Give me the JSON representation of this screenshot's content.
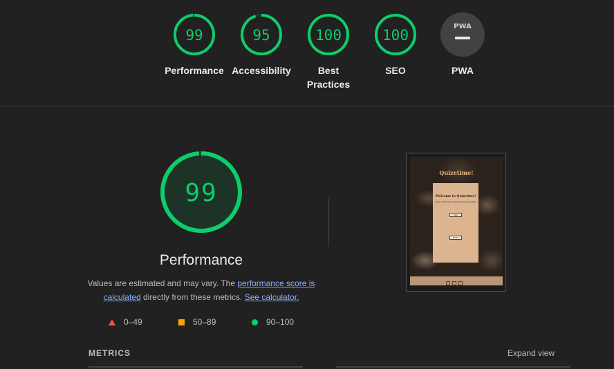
{
  "scores": [
    {
      "label": "Performance",
      "value": "99",
      "fraction": 0.99
    },
    {
      "label": "Accessibility",
      "value": "95",
      "fraction": 0.95
    },
    {
      "label": "Best Practices",
      "value": "100",
      "fraction": 1.0
    },
    {
      "label": "SEO",
      "value": "100",
      "fraction": 1.0
    },
    {
      "label": "PWA",
      "value": "",
      "badge_text": "PWA"
    }
  ],
  "main": {
    "score": "99",
    "score_fraction": 0.99,
    "title": "Performance",
    "desc_prefix": "Values are estimated and may vary. The ",
    "desc_link1": "performance score is calculated",
    "desc_middle": " directly from these metrics. ",
    "desc_link2": "See calculator."
  },
  "legend": [
    {
      "range": "0–49",
      "color": "#ff4e42",
      "shape": "triangle"
    },
    {
      "range": "50–89",
      "color": "#ffa400",
      "shape": "square"
    },
    {
      "range": "90–100",
      "color": "#0cce6b",
      "shape": "circle"
    }
  ],
  "thumbnail": {
    "app_title": "Quizetime!",
    "card_heading": "Welcome to Quizetime!",
    "card_text": "Press click Start and let the fun begin!",
    "start_label": "Start",
    "rules_label": "Rules"
  },
  "metrics": {
    "header": "METRICS",
    "expand_label": "Expand view"
  },
  "colors": {
    "pass": "#0cce6b",
    "average": "#ffa400",
    "fail": "#ff4e42",
    "background": "#212121"
  }
}
